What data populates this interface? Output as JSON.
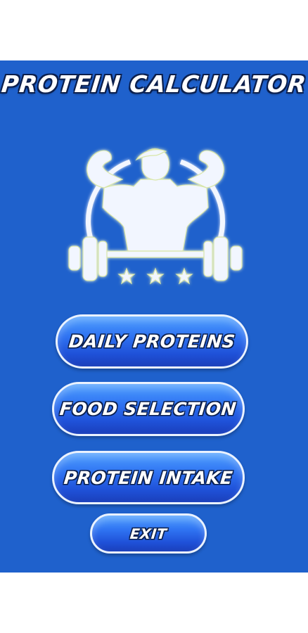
{
  "app": {
    "title": "PROTEIN CALCULATOR"
  },
  "logo": {
    "icon": "bodybuilder-barbell-icon",
    "stars": 3
  },
  "menu": {
    "daily_proteins": "DAILY PROTEINS",
    "food_selection": "FOOD SELECTION",
    "protein_intake": "PROTEIN INTAKE",
    "exit": "EXIT"
  },
  "colors": {
    "background": "#1f61cc",
    "button_top": "#4fa0ff",
    "button_bottom": "#1a3fbb",
    "text": "#ffffff",
    "outline": "#0b1f4d"
  }
}
